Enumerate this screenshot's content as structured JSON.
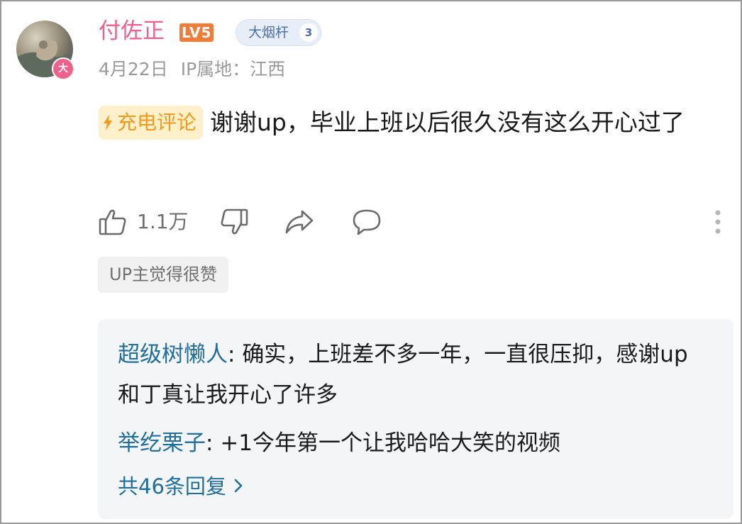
{
  "comment": {
    "username": "付佐正",
    "level_badge": "LV5",
    "fan_medal": {
      "name": "大烟杆",
      "level": "3"
    },
    "avatar_badge": "大",
    "date": "4月22日",
    "ip_location": "IP属地：江西",
    "charge_tag": "充电评论",
    "text": "谢谢up，毕业上班以后很久没有这么开心过了",
    "like_count": "1.1万",
    "up_liked_label": "UP主觉得很赞"
  },
  "icons": {
    "like": "thumbs-up-icon",
    "dislike": "thumbs-down-icon",
    "share": "share-arrow-icon",
    "reply": "speech-bubble-icon",
    "more": "more-vertical-icon",
    "charge": "lightning-bolt-icon"
  },
  "colors": {
    "username": "#f0608a",
    "level_badge": "#f07c3a",
    "charge_tag_text": "#f39a1a",
    "charge_tag_bg": "#fff0cc",
    "reply_name": "#1f6f9a"
  },
  "replies": {
    "items": [
      {
        "name": "超级树懒人",
        "sep": ": ",
        "text": "确实，上班差不多一年，一直很压抑，感谢up和丁真让我开心了许多"
      },
      {
        "name": "举纥栗子",
        "sep": ": ",
        "text": "+1今年第一个让我哈哈大笑的视频"
      }
    ],
    "total_label": "共46条回复"
  }
}
